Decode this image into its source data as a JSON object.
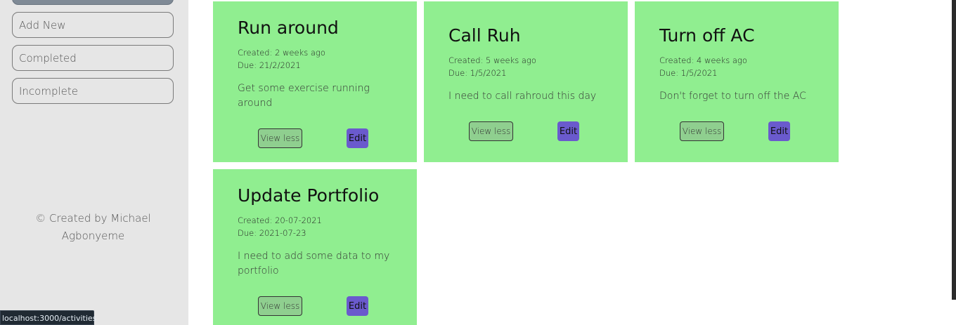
{
  "sidebar": {
    "nav": [
      "",
      "Add New",
      "Completed",
      "Incomplete"
    ],
    "credit": "© Created by Michael Agbonyeme"
  },
  "cards": [
    {
      "title": "Run around",
      "created": "Created: 2 weeks ago",
      "due": "Due: 21/2/2021",
      "description": "Get some exercise running around",
      "view_label": "View less",
      "edit_label": "Edit"
    },
    {
      "title": "Call Ruh",
      "created": "Created: 5 weeks ago",
      "due": "Due: 1/5/2021",
      "description": "I need to call rahroud this day",
      "view_label": "View less",
      "edit_label": "Edit"
    },
    {
      "title": "Turn off AC",
      "created": "Created: 4 weeks ago",
      "due": "Due: 1/5/2021",
      "description": "Don't forget to turn off the AC",
      "view_label": "View less",
      "edit_label": "Edit"
    },
    {
      "title": "Update Portfolio",
      "created": "Created: 20-07-2021",
      "due": "Due: 2021-07-23",
      "description": "I need to add some data to my portfolio",
      "view_label": "View less",
      "edit_label": "Edit"
    }
  ],
  "status_bar": {
    "url": "localhost:3000/activities"
  },
  "colors": {
    "card_bg": "#90ee90",
    "edit_button": "#6a5acd",
    "sidebar_bg": "#e6e6e6"
  }
}
